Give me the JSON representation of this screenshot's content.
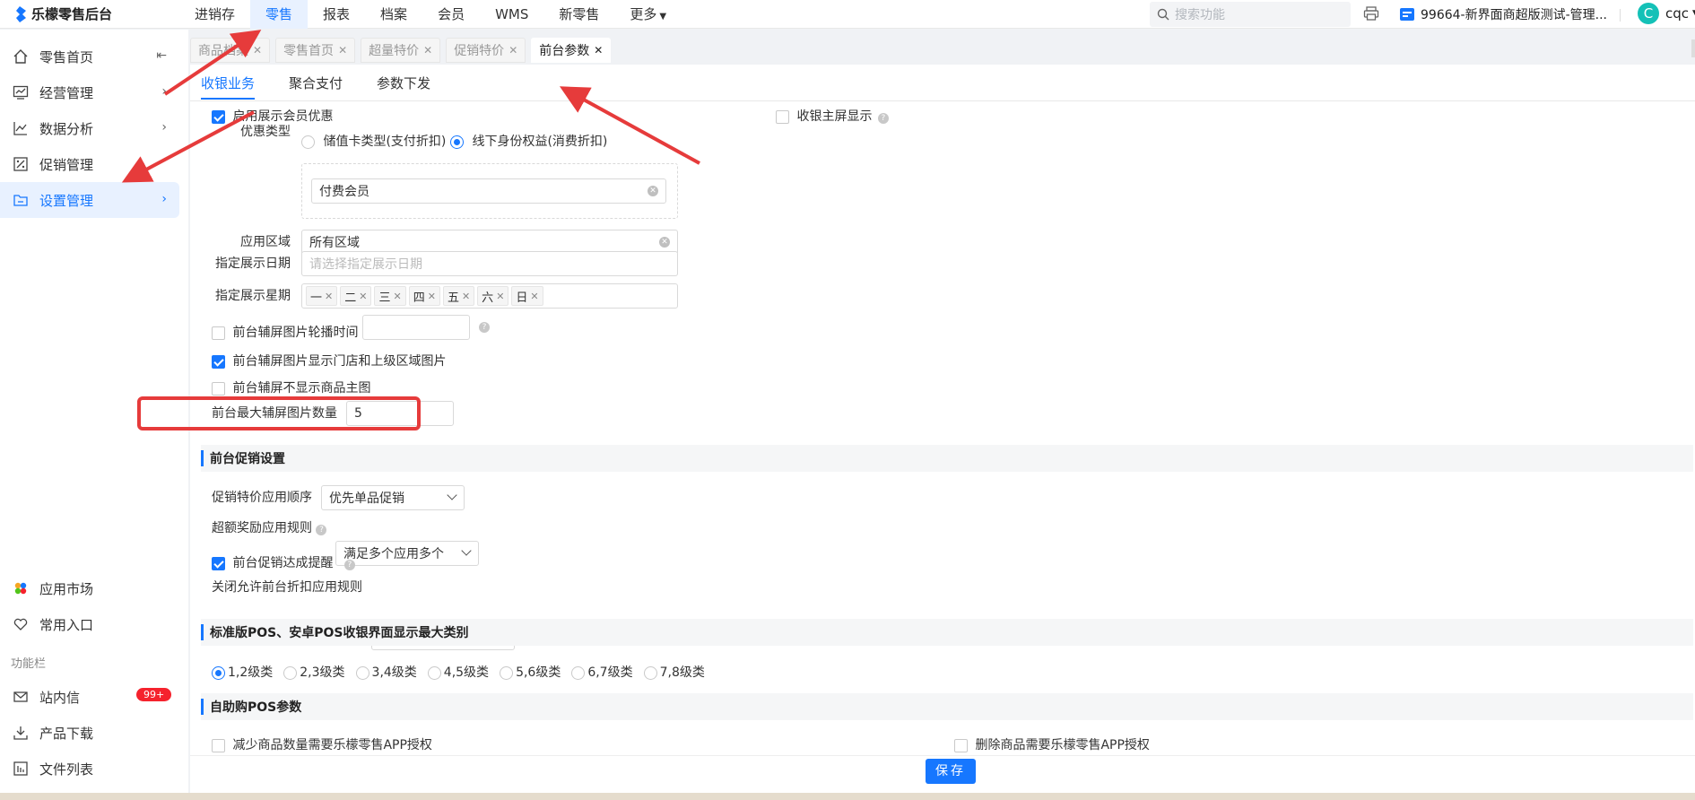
{
  "app": {
    "title": "乐檬零售后台"
  },
  "topnav": [
    "进销存",
    "零售",
    "报表",
    "档案",
    "会员",
    "WMS",
    "新零售",
    "更多"
  ],
  "search": {
    "placeholder": "搜索功能"
  },
  "store": {
    "name": "99664-新界面商超版测试-管理..."
  },
  "user": {
    "initial": "C",
    "name": "cqc"
  },
  "sidebar": {
    "items": [
      "零售首页",
      "经营管理",
      "数据分析",
      "促销管理",
      "设置管理"
    ],
    "bottom": [
      "应用市场",
      "常用入口"
    ],
    "section_label": "功能栏",
    "tools": [
      "站内信",
      "产品下载",
      "文件列表"
    ],
    "badge": "99+"
  },
  "tabs": [
    "商品档案",
    "零售首页",
    "超量特价",
    "促销特价",
    "前台参数"
  ],
  "subtabs": [
    "收银业务",
    "聚合支付",
    "参数下发"
  ],
  "form": {
    "show_member_discount": "启用展示会员优惠",
    "main_screen_show": "收银主屏显示",
    "discount_type_label": "优惠类型",
    "discount_type_options": [
      "储值卡类型(支付折扣)",
      "线下身份权益(消费折扣)"
    ],
    "paid_member": "付费会员",
    "area_label": "应用区域",
    "area_value": "所有区域",
    "date_label": "指定展示日期",
    "date_placeholder": "请选择指定展示日期",
    "week_label": "指定展示星期",
    "weekdays": [
      "一",
      "二",
      "三",
      "四",
      "五",
      "六",
      "日"
    ],
    "carousel_time": "前台辅屏图片轮播时间",
    "show_store_images": "前台辅屏图片显示门店和上级区域图片",
    "hide_main_image": "前台辅屏不显示商品主图",
    "max_images_label": "前台最大辅屏图片数量",
    "max_images_value": "5"
  },
  "promo": {
    "section": "前台促销设置",
    "order_label": "促销特价应用顺序",
    "order_value": "优先单品促销",
    "reward_label": "超额奖励应用规则",
    "reward_value": "满足多个应用多个",
    "reminder": "前台促销达成提醒",
    "discount_rule_label": "关闭允许前台折扣应用规则"
  },
  "pos": {
    "section": "标准版POS、安卓POS收银界面显示最大类别",
    "levels": [
      "1,2级类",
      "2,3级类",
      "3,4级类",
      "4,5级类",
      "5,6级类",
      "6,7级类",
      "7,8级类"
    ]
  },
  "self_pos": {
    "section": "自助购POS参数",
    "reduce_qty": "减少商品数量需要乐檬零售APP授权",
    "delete_item": "删除商品需要乐檬零售APP授权"
  },
  "save": "保存",
  "colors": {
    "accent": "#1677ff",
    "annotation_red": "#e63b3b"
  }
}
